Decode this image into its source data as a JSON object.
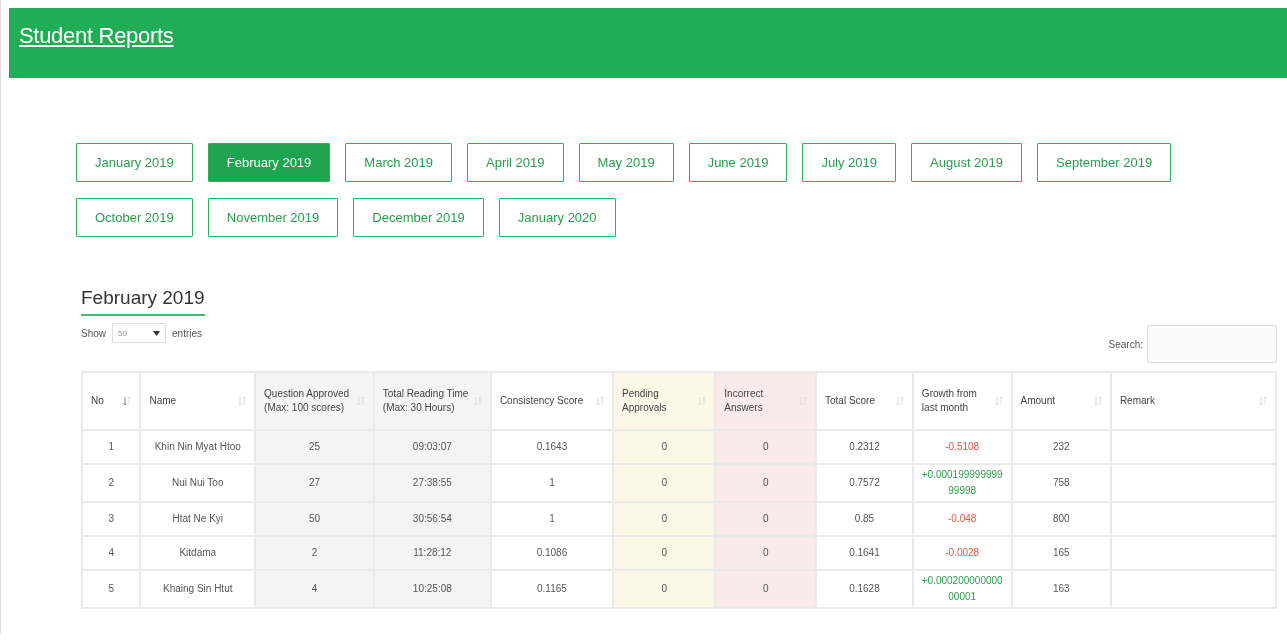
{
  "header": {
    "title": "Student Reports"
  },
  "months": [
    {
      "label": "January 2019",
      "selected": false
    },
    {
      "label": "February 2019",
      "selected": true
    },
    {
      "label": "March 2019",
      "selected": false
    },
    {
      "label": "April 2019",
      "selected": false
    },
    {
      "label": "May 2019",
      "selected": false
    },
    {
      "label": "June 2019",
      "selected": false
    },
    {
      "label": "July 2019",
      "selected": false
    },
    {
      "label": "August 2019",
      "selected": false
    },
    {
      "label": "September 2019",
      "selected": false
    },
    {
      "label": "October 2019",
      "selected": false
    },
    {
      "label": "November 2019",
      "selected": false
    },
    {
      "label": "December 2019",
      "selected": false
    },
    {
      "label": "January 2020",
      "selected": false
    }
  ],
  "report": {
    "heading": "February 2019",
    "length": {
      "show": "Show",
      "value": "50",
      "entries": "entries"
    },
    "search": {
      "label": "Search:"
    },
    "columns": [
      {
        "title": "No",
        "color": "#ffffff",
        "sorted": true
      },
      {
        "title": "Name",
        "color": "#ffffff",
        "sorted": false
      },
      {
        "title": "Question Approved (Max: 100 scores)",
        "color": "#f4f4f4",
        "sorted": false
      },
      {
        "title": "Total Reading Time (Max: 30 Hours)",
        "color": "#f4f4f4",
        "sorted": false
      },
      {
        "title": "Consistency Score",
        "color": "#ffffff",
        "sorted": false
      },
      {
        "title": "Pending Approvals",
        "color": "#fdf7e6",
        "sorted": false
      },
      {
        "title": "Incorrect Answers",
        "color": "#fbeaea",
        "sorted": false
      },
      {
        "title": "Total Score",
        "color": "#ffffff",
        "sorted": false
      },
      {
        "title": "Growth from last month",
        "color": "#ffffff",
        "sorted": false
      },
      {
        "title": "Amount",
        "color": "#ffffff",
        "sorted": false
      },
      {
        "title": "Remark",
        "color": "#ffffff",
        "sorted": false
      }
    ],
    "rows": [
      {
        "cells": [
          "1",
          "Khin Nin Myat Htoo",
          "25",
          "09:03:07",
          "0.1643",
          "0",
          "0",
          "0.2312",
          "-0.5108",
          "232",
          ""
        ],
        "growth_positive": false
      },
      {
        "cells": [
          "2",
          "Nui Nui Too",
          "27",
          "27:38:55",
          "1",
          "0",
          "0",
          "0.7572",
          "+0.00019999999999998",
          "758",
          ""
        ],
        "growth_positive": true
      },
      {
        "cells": [
          "3",
          "Htat Ne Kyi",
          "50",
          "30:56:54",
          "1",
          "0",
          "0",
          "0.85",
          "-0.048",
          "800",
          ""
        ],
        "growth_positive": false
      },
      {
        "cells": [
          "4",
          "Kitdama",
          "2",
          "11:28:12",
          "0.1086",
          "0",
          "0",
          "0.1641",
          "-0.0028",
          "165",
          ""
        ],
        "growth_positive": false
      },
      {
        "cells": [
          "5",
          "Khaing Sin Htut",
          "4",
          "10:25:08",
          "0.1165",
          "0",
          "0",
          "0.1628",
          "+0.00020000000000001",
          "163",
          ""
        ],
        "growth_positive": true
      }
    ]
  }
}
